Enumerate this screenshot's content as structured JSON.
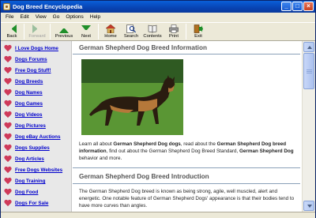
{
  "window": {
    "title": "Dog Breed Encyclopedia",
    "controls": {
      "minimize": "_",
      "maximize": "□",
      "close": "×"
    }
  },
  "menu": [
    "File",
    "Edit",
    "View",
    "Go",
    "Options",
    "Help"
  ],
  "toolbar": {
    "back": "Back",
    "forward": "Forward",
    "previous": "Previous",
    "next": "Next",
    "home": "Home",
    "search": "Search",
    "contents": "Contents",
    "print": "Print",
    "exit": "Exit"
  },
  "sidebar": {
    "items": [
      "I Love Dogs Home",
      "Dogs Forums",
      "Free Dog Stuff!",
      "Dog Breeds",
      "Dog Names",
      "Dog Games",
      "Dog Videos",
      "Dog Pictures",
      "Dog eBay Auctions",
      "Dogs Supplies",
      "Dog Articles",
      "Free Dogs Websites",
      "Dog Training",
      "Dog Food",
      "Dogs For Sale"
    ]
  },
  "article": {
    "heading": "German Shepherd Dog Breed Information",
    "intro_parts": [
      "Learn all about ",
      "German Shepherd Dog dogs",
      ", read about the ",
      "German Shepherd Dog breed information",
      ", find out about the German Shepherd Dog Breed Standard, ",
      "German Shepherd Dog",
      " behavior and more."
    ],
    "section_heading": "German Shepherd Dog Breed Introduction",
    "section_text": "The German Shepherd Dog breed is known as being strong, agile, well muscled, alert and energetic. One notable feature of German Shepherd Dogs' appearance is that their bodies tend to have more curves than angles."
  },
  "colors": {
    "title_bar": "#0843b3",
    "link": "#0000cc",
    "heading": "#555555",
    "heart": "#cf3a5a",
    "sidebar_bg": "#e8e8e8"
  },
  "icons": [
    "back-arrow-icon",
    "forward-arrow-icon",
    "previous-arrow-icon",
    "next-arrow-icon",
    "home-icon",
    "search-icon",
    "contents-icon",
    "print-icon",
    "exit-icon",
    "heart-icon"
  ]
}
